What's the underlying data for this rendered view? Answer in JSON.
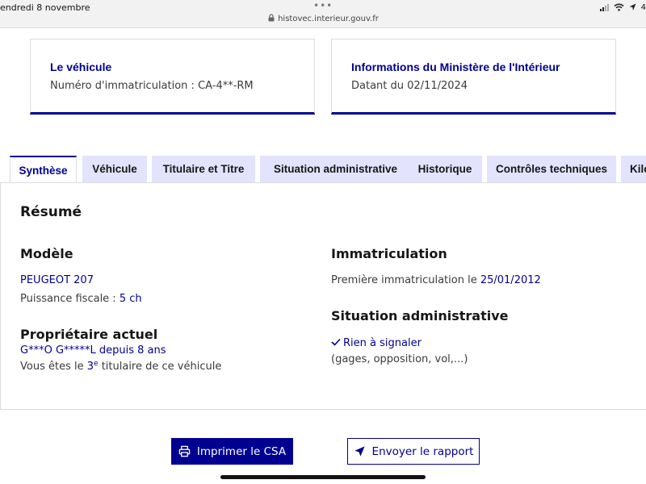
{
  "status_bar": {
    "time_date": "endredi 8 novembre",
    "dots": "•••",
    "url": "histovec.interieur.gouv.fr",
    "battery": "4"
  },
  "cards": {
    "vehicle": {
      "title": "Le véhicule",
      "text": "Numéro d'immatriculation : CA-4**-RM"
    },
    "ministry": {
      "title": "Informations du Ministère de l'Intérieur",
      "text": "Datant du 02/11/2024"
    }
  },
  "tabs": [
    {
      "label": "Synthèse",
      "active": true
    },
    {
      "label": "Véhicule",
      "active": false
    },
    {
      "label": "Titulaire et Titre",
      "active": false
    },
    {
      "label": "Situation administrative",
      "active": false
    },
    {
      "label": "Historique",
      "active": false
    },
    {
      "label": "Contrôles techniques",
      "active": false
    },
    {
      "label": "Kilo",
      "active": false
    }
  ],
  "summary": {
    "title": "Résumé",
    "model": {
      "heading": "Modèle",
      "name": "PEUGEOT 207",
      "power_label": "Puissance fiscale : ",
      "power_value": "5 ch"
    },
    "owner": {
      "heading": "Propriétaire actuel",
      "name": "G***O G*****L",
      "since_label": " depuis ",
      "since_value": "8 ans",
      "rank_prefix": "Vous êtes le ",
      "rank_number": "3",
      "rank_sup": "e",
      "rank_suffix": " titulaire de ce véhicule"
    },
    "registration": {
      "heading": "Immatriculation",
      "label": "Première immatriculation le ",
      "date": "25/01/2012"
    },
    "admin": {
      "heading": "Situation administrative",
      "status": "Rien à signaler",
      "details": "(gages, opposition, vol,...)"
    }
  },
  "actions": {
    "print_label": "Imprimer le CSA",
    "send_label": "Envoyer le rapport"
  },
  "colors": {
    "primary": "#000091",
    "tab_inactive_bg": "#e3e3fd",
    "text": "#161616",
    "muted": "#3a3a3a"
  }
}
